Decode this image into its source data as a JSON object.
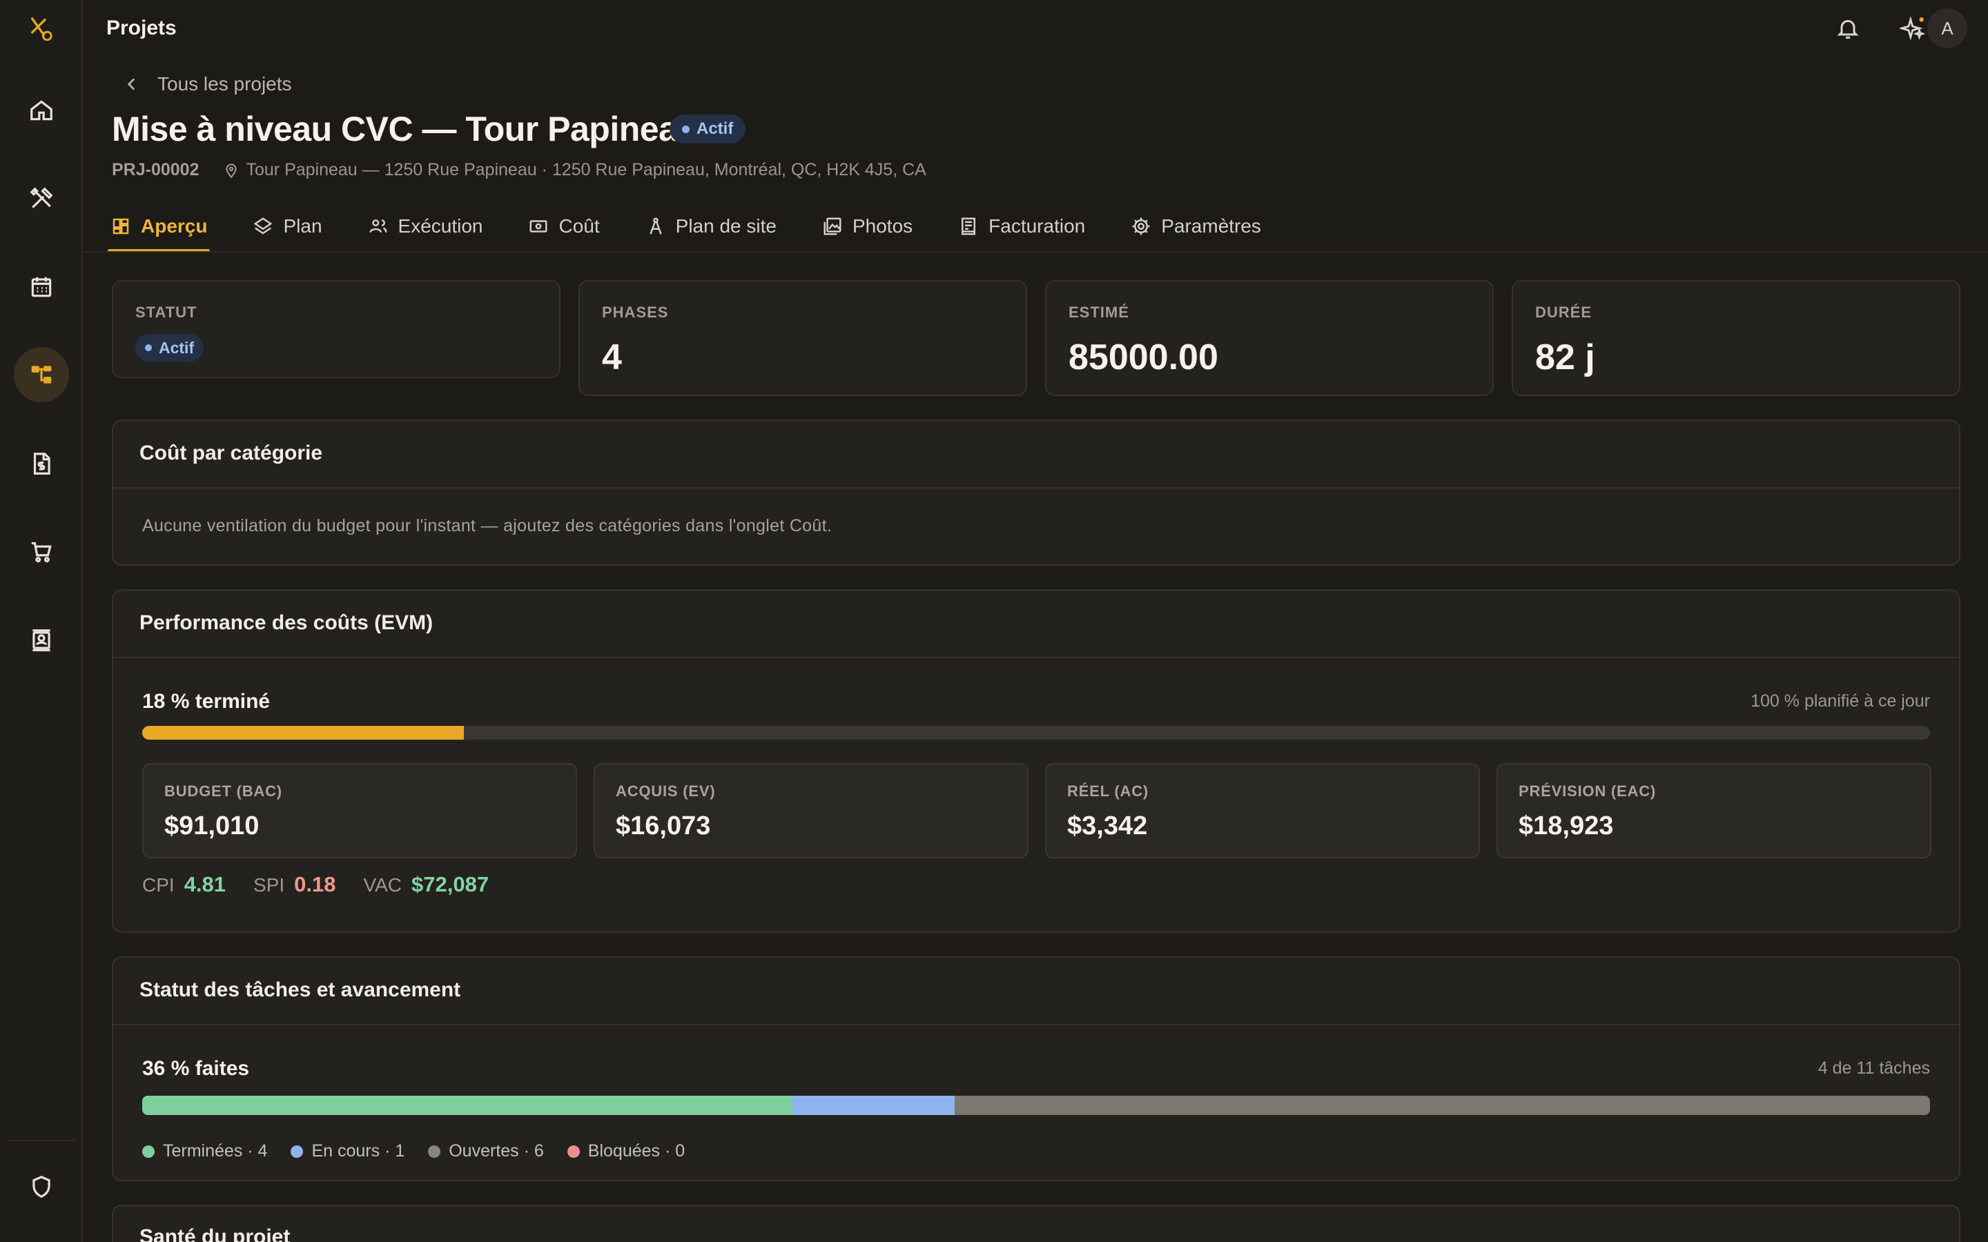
{
  "app": {
    "title": "Projets",
    "avatar_initial": "A"
  },
  "breadcrumb": {
    "back_label": "Tous les projets"
  },
  "project": {
    "title": "Mise à niveau CVC — Tour Papineau",
    "status": "Actif",
    "code": "PRJ-00002",
    "location": "Tour Papineau — 1250 Rue Papineau · 1250 Rue Papineau, Montréal, QC, H2K 4J5, CA"
  },
  "tabs": [
    {
      "label": "Aperçu",
      "icon": "dashboard-icon",
      "active": true
    },
    {
      "label": "Plan",
      "icon": "layers-icon"
    },
    {
      "label": "Exécution",
      "icon": "people-icon"
    },
    {
      "label": "Coût",
      "icon": "money-icon"
    },
    {
      "label": "Plan de site",
      "icon": "compass-icon"
    },
    {
      "label": "Photos",
      "icon": "photos-icon"
    },
    {
      "label": "Facturation",
      "icon": "invoice-icon"
    },
    {
      "label": "Paramètres",
      "icon": "gear-icon"
    }
  ],
  "stats": {
    "statut": {
      "label": "STATUT",
      "value": "Actif"
    },
    "phases": {
      "label": "PHASES",
      "value": "4"
    },
    "estime": {
      "label": "ESTIMÉ",
      "value": "85000.00"
    },
    "duree": {
      "label": "DURÉE",
      "value": "82 j"
    }
  },
  "cost_category": {
    "title": "Coût par catégorie",
    "empty_text": "Aucune ventilation du budget pour l'instant — ajoutez des catégories dans l'onglet Coût."
  },
  "evm": {
    "title": "Performance des coûts (EVM)",
    "progress_label": "18 % terminé",
    "progress_percent": 18,
    "planned_label": "100 % planifié à ce jour",
    "budget": {
      "label": "BUDGET (BAC)",
      "value": "$91,010"
    },
    "acquis": {
      "label": "ACQUIS (EV)",
      "value": "$16,073"
    },
    "reel": {
      "label": "RÉEL (AC)",
      "value": "$3,342"
    },
    "prevision": {
      "label": "PRÉVISION (EAC)",
      "value": "$18,923"
    },
    "cpi": {
      "label": "CPI",
      "value": "4.81"
    },
    "spi": {
      "label": "SPI",
      "value": "0.18"
    },
    "vac": {
      "label": "VAC",
      "value": "$72,087"
    }
  },
  "tasks": {
    "title": "Statut des tâches et avancement",
    "progress_label": "36 % faites",
    "count_label": "4 de 11 tâches",
    "done": 4,
    "in_progress": 1,
    "open": 6,
    "blocked": 0,
    "total": 11,
    "legend": {
      "done": "Terminées · 4",
      "in_progress": "En cours · 1",
      "open": "Ouvertes · 6",
      "blocked": "Bloquées · 0"
    }
  },
  "health": {
    "title": "Santé du projet"
  },
  "colors": {
    "accent": "#e9a825",
    "done": "#7fcf9c",
    "in_progress": "#8fb3ee",
    "open": "#7d786f",
    "blocked": "#ee8f8f",
    "positive": "#7fd6a0",
    "negative": "#f19a8a"
  }
}
